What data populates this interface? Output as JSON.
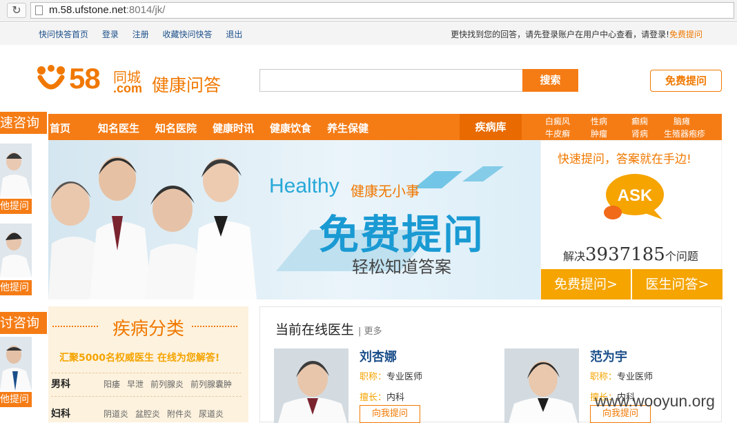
{
  "browser": {
    "url_host": "m.58.ufstone.net",
    "url_rest": ":8014/jk/",
    "reload_icon": "reload-icon"
  },
  "topbar": {
    "links": [
      "快问快答首页",
      "登录",
      "注册",
      "收藏快问快答",
      "退出"
    ],
    "notice": "更快找到您的回答，请先登录账户在用户中心查看，请登录!",
    "notice_link": "免费提问"
  },
  "logo": {
    "brand": "58",
    "city": "同城",
    "com": ".com",
    "product": "健康问答"
  },
  "search": {
    "value": "",
    "button": "搜索"
  },
  "ask_button": "免费提问",
  "nav": {
    "items": [
      "首页",
      "知名医生",
      "知名医院",
      "健康时讯",
      "健康饮食",
      "养生保健"
    ],
    "disease_lib": "疾病库",
    "diseases": [
      "白癜风",
      "性病",
      "癫痫",
      "脑瘫",
      "牛皮癣",
      "肿瘤",
      "肾病",
      "生殖器疱疹"
    ]
  },
  "left_strip": {
    "title1": "速咨询",
    "title2": "讨咨询",
    "ask_label": "他提问"
  },
  "banner": {
    "healthy": "Healthy",
    "tagline": "健康无小事",
    "headline": "免费提问",
    "sub": "轻松知道答案"
  },
  "ask_panel": {
    "title": "快速提问，答案就在手边!",
    "bubble_text": "ASK",
    "solve_prefix": "解决",
    "solve_count": "3937185",
    "solve_suffix": "个问题",
    "btn_free": "免费提问",
    "btn_doctor": "医生问答",
    "btn_arrow": ">",
    "colors": {
      "accent": "#f5a400",
      "brand": "#f57c15"
    }
  },
  "categories": {
    "title": "疾病分类",
    "subtitle": "汇聚5000名权威医生 在线为您解答!",
    "rows": [
      {
        "name": "男科",
        "tags": [
          "阳痿",
          "早泄",
          "前列腺炎",
          "前列腺囊肿"
        ]
      },
      {
        "name": "妇科",
        "tags": [
          "阴道炎",
          "盆腔炎",
          "附件炎",
          "尿道炎"
        ]
      }
    ]
  },
  "doctors": {
    "title": "当前在线医生",
    "more": "| 更多",
    "title_key": "职称：",
    "spec_key": "擅长：",
    "ask_btn": "向我提问",
    "list": [
      {
        "name": "刘杏娜",
        "title": "专业医师",
        "specialty": "内科"
      },
      {
        "name": "范为宇",
        "title": "专业医师",
        "specialty": "内科"
      }
    ]
  },
  "watermark": "www.wooyun.org"
}
